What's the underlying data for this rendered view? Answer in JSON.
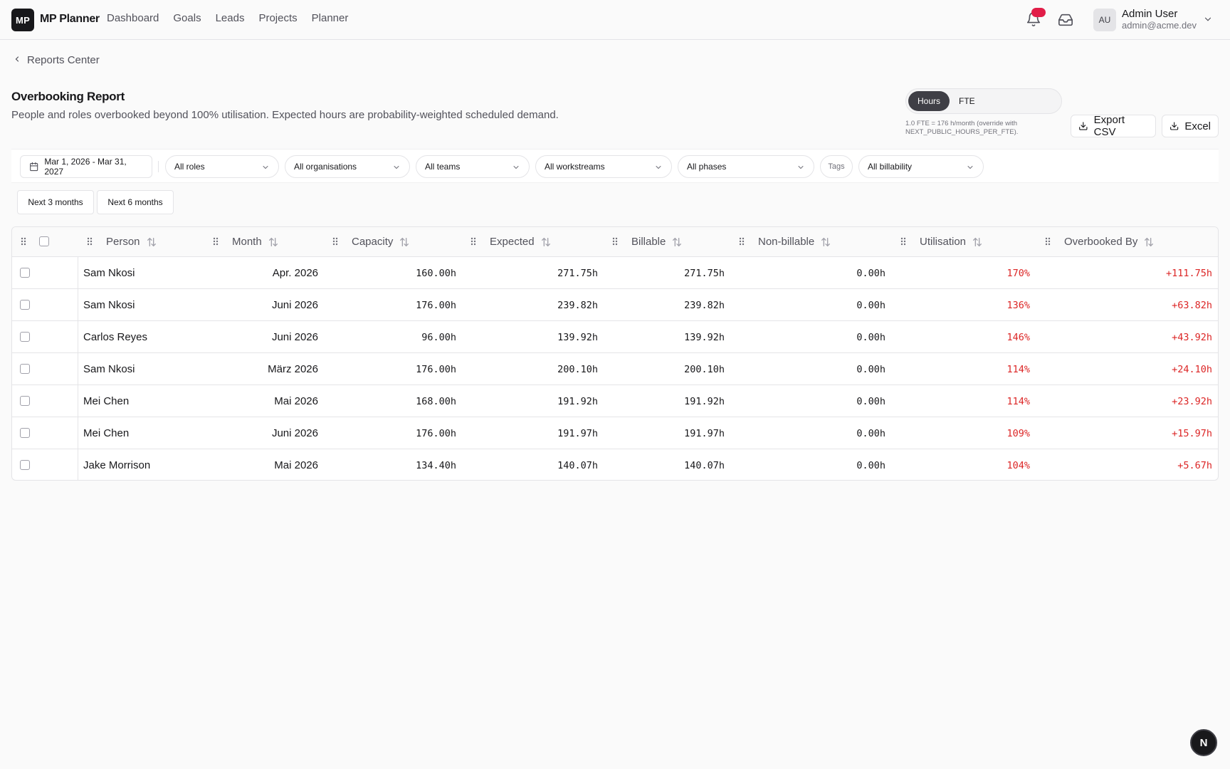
{
  "app": {
    "logo": "MP",
    "name": "MP Planner"
  },
  "nav": {
    "items": [
      "Dashboard",
      "Goals",
      "Leads",
      "Projects",
      "Planner"
    ]
  },
  "user": {
    "initials": "AU",
    "name": "Admin User",
    "email": "admin@acme.dev"
  },
  "notifications": {
    "count": ""
  },
  "breadcrumb": {
    "label": "Reports Center"
  },
  "page": {
    "title": "Overbooking Report",
    "subtitle": "People and roles overbooked beyond 100% utilisation. Expected hours are probability-weighted scheduled demand."
  },
  "units": {
    "hours": "Hours",
    "fte": "FTE",
    "selected": "Hours",
    "note": "1.0 FTE = 176 h/month (override with NEXT_PUBLIC_HOURS_PER_FTE)."
  },
  "actions": {
    "export_csv": "Export CSV",
    "excel": "Excel"
  },
  "filters": {
    "date_range": "Mar 1, 2026 - Mar 31, 2027",
    "roles": "All roles",
    "organisations": "All organisations",
    "teams": "All teams",
    "workstreams": "All workstreams",
    "phases": "All phases",
    "tags": "Tags",
    "billability": "All billability"
  },
  "presets": [
    "Next 3 months",
    "Next 6 months"
  ],
  "table": {
    "columns": [
      "Person",
      "Month",
      "Capacity",
      "Expected",
      "Billable",
      "Non-billable",
      "Utilisation",
      "Overbooked By"
    ],
    "rows": [
      {
        "person": "Sam Nkosi",
        "month": "Apr. 2026",
        "capacity": "160.00h",
        "expected": "271.75h",
        "billable": "271.75h",
        "nonbillable": "0.00h",
        "utilisation": "170%",
        "overbooked": "+111.75h"
      },
      {
        "person": "Sam Nkosi",
        "month": "Juni 2026",
        "capacity": "176.00h",
        "expected": "239.82h",
        "billable": "239.82h",
        "nonbillable": "0.00h",
        "utilisation": "136%",
        "overbooked": "+63.82h"
      },
      {
        "person": "Carlos Reyes",
        "month": "Juni 2026",
        "capacity": "96.00h",
        "expected": "139.92h",
        "billable": "139.92h",
        "nonbillable": "0.00h",
        "utilisation": "146%",
        "overbooked": "+43.92h"
      },
      {
        "person": "Sam Nkosi",
        "month": "März 2026",
        "capacity": "176.00h",
        "expected": "200.10h",
        "billable": "200.10h",
        "nonbillable": "0.00h",
        "utilisation": "114%",
        "overbooked": "+24.10h"
      },
      {
        "person": "Mei Chen",
        "month": "Mai 2026",
        "capacity": "168.00h",
        "expected": "191.92h",
        "billable": "191.92h",
        "nonbillable": "0.00h",
        "utilisation": "114%",
        "overbooked": "+23.92h"
      },
      {
        "person": "Mei Chen",
        "month": "Juni 2026",
        "capacity": "176.00h",
        "expected": "191.97h",
        "billable": "191.97h",
        "nonbillable": "0.00h",
        "utilisation": "109%",
        "overbooked": "+15.97h"
      },
      {
        "person": "Jake Morrison",
        "month": "Mai 2026",
        "capacity": "134.40h",
        "expected": "140.07h",
        "billable": "140.07h",
        "nonbillable": "0.00h",
        "utilisation": "104%",
        "overbooked": "+5.67h"
      }
    ]
  },
  "fab": {
    "label": "N"
  },
  "colors": {
    "accent_dark": "#18181b",
    "over_red": "#dc2626",
    "badge": "#e11d48"
  }
}
